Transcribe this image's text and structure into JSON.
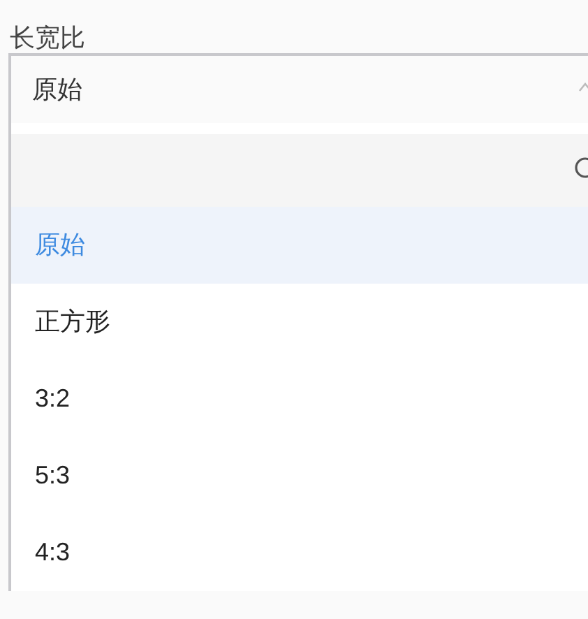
{
  "label": "长宽比",
  "select": {
    "value": "原始",
    "expanded": true
  },
  "options": [
    {
      "label": "原始",
      "selected": true
    },
    {
      "label": "正方形",
      "selected": false
    },
    {
      "label": "3:2",
      "selected": false
    },
    {
      "label": "5:3",
      "selected": false
    },
    {
      "label": "4:3",
      "selected": false
    }
  ]
}
